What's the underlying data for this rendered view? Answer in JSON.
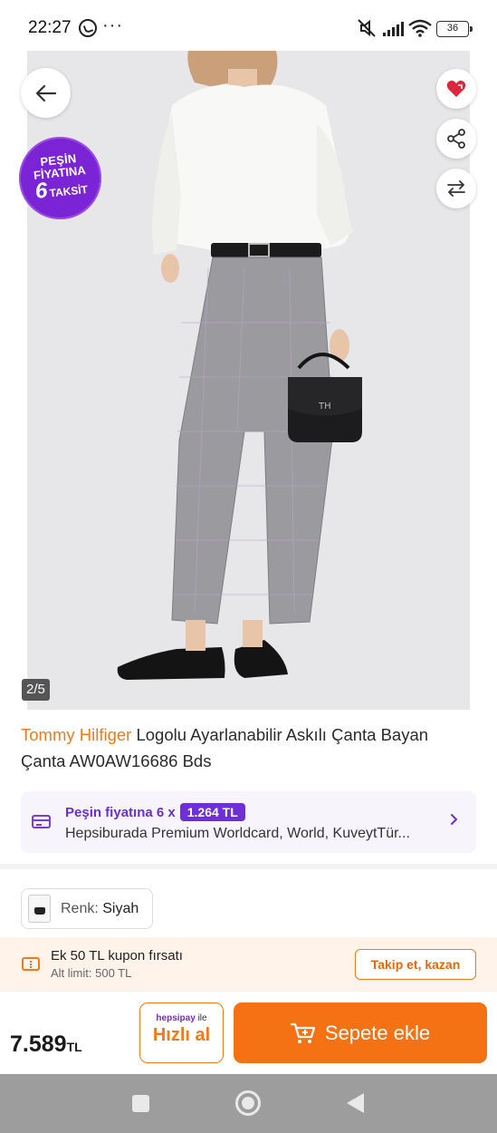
{
  "status_bar": {
    "time": "22:27",
    "dots": "···",
    "battery": "36",
    "icons": [
      "whatsapp-icon",
      "mute-icon",
      "signal-icon",
      "wifi-icon",
      "battery-icon"
    ]
  },
  "gallery": {
    "counter": "2/5",
    "image": "product-model-photo",
    "promo_badge": {
      "line1": "PEŞİN",
      "line2": "FİYATINA",
      "number": "6",
      "word": "TAKSİT"
    },
    "actions": [
      "back-arrow-icon",
      "favorite-heart-icon",
      "share-icon",
      "compare-icon"
    ]
  },
  "product": {
    "brand": "Tommy Hilfiger",
    "title": "Logolu Ayarlanabilir Askılı Çanta Bayan Çanta AW0AW16686 Bds"
  },
  "installment": {
    "prefix": "Peşin fiyatına 6 x",
    "amount": "1.264 TL",
    "cards": "Hepsiburada Premium Worldcard, World, KuveytTür..."
  },
  "color": {
    "label": "Renk:",
    "value": "Siyah"
  },
  "coupon": {
    "title": "Ek 50 TL kupon fırsatı",
    "subtitle": "Alt limit: 500 TL",
    "button": "Takip et, kazan"
  },
  "buy_bar": {
    "price": "7.589",
    "currency": "TL",
    "quick_brand": "hepsipay",
    "quick_suffix": "ile",
    "quick_label": "Hızlı al",
    "cart_label": "Sepete ekle"
  },
  "colors": {
    "accent_orange": "#f27a1a",
    "purple": "#7a24d6",
    "cart_button": "#f57214"
  }
}
